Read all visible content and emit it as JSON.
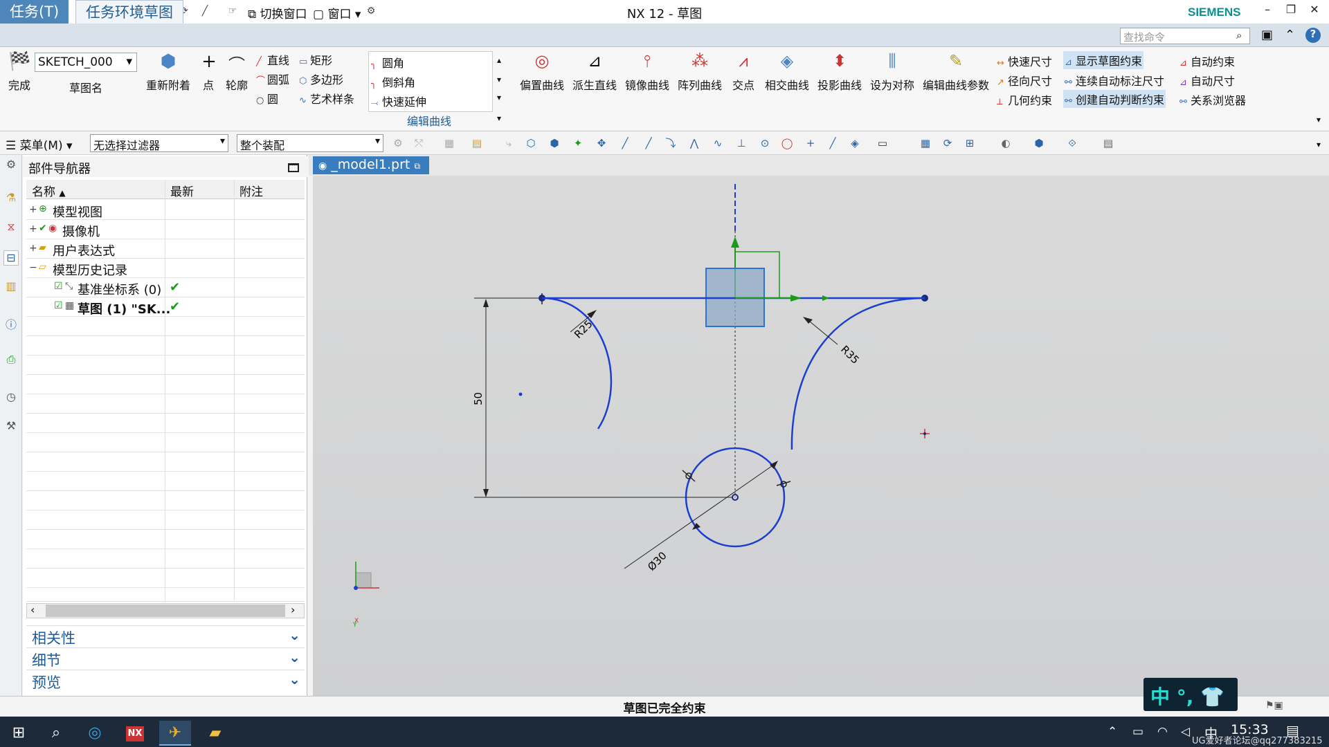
{
  "titlebar": {
    "logo": "NX",
    "title": "NX 12 - 草图",
    "switch_window": "切换窗口",
    "window_menu": "窗口",
    "brand": "SIEMENS"
  },
  "ribbon_tabs": [
    "任务(T)",
    "任务环境草图"
  ],
  "search_placeholder": "查找命令",
  "ribbon": {
    "finish": "完成",
    "sketch_name_value": "SKETCH_000",
    "sketch_name_label": "草图名",
    "reattach": "重新附着",
    "point": "点",
    "profile": "轮廓",
    "line": "直线",
    "rectangle": "矩形",
    "arc": "圆弧",
    "polygon": "多边形",
    "circle": "圆",
    "studio_spline": "艺术样条",
    "fillet": "圆角",
    "chamfer": "倒斜角",
    "quick_extend": "快速延伸",
    "edit_curve_group": "编辑曲线",
    "big_buttons": [
      "偏置曲线",
      "派生直线",
      "镜像曲线",
      "阵列曲线",
      "交点",
      "相交曲线",
      "投影曲线",
      "设为对称",
      "编辑曲线参数"
    ],
    "right_col1": [
      "快速尺寸",
      "径向尺寸",
      "几何约束"
    ],
    "right_col2": [
      "显示草图约束",
      "连续自动标注尺寸",
      "创建自动判断约束"
    ],
    "right_col3": [
      "自动约束",
      "自动尺寸",
      "关系浏览器"
    ]
  },
  "toolbar": {
    "menu": "菜单(M)",
    "filter": "无选择过滤器",
    "assembly": "整个装配"
  },
  "navigator": {
    "title": "部件导航器",
    "columns": [
      "名称",
      "最新",
      "附注"
    ],
    "rows": [
      {
        "label": "模型视图",
        "expand": "+",
        "check": ""
      },
      {
        "label": "摄像机",
        "expand": "+",
        "check": ""
      },
      {
        "label": "用户表达式",
        "expand": "+",
        "check": ""
      },
      {
        "label": "模型历史记录",
        "expand": "−",
        "check": ""
      },
      {
        "label": "基准坐标系 (0)",
        "expand": "",
        "check": "✔"
      },
      {
        "label": "草图 (1) \"SK...",
        "expand": "",
        "check": "✔"
      }
    ],
    "sections": [
      "相关性",
      "细节",
      "预览"
    ]
  },
  "document_tab": "_model1.prt",
  "sketch": {
    "dim_r25": "R25",
    "dim_r35": "R35",
    "dim_50": "50",
    "dim_d30": "Ø30",
    "axis_x": "X",
    "axis_y": "Y"
  },
  "status": "草图已完全约束",
  "ime": "中 °, 👕",
  "clock": "15:33",
  "tray_ime": "中",
  "watermark": "UG爱好者论坛@qq277383215"
}
